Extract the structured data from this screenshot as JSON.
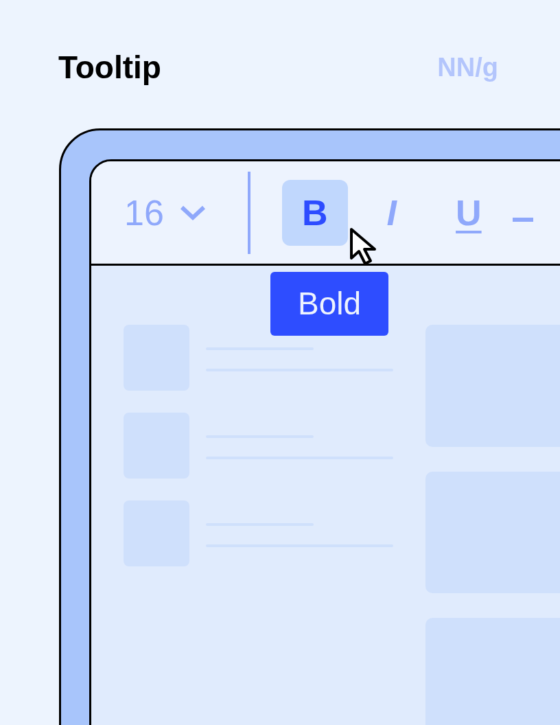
{
  "title": "Tooltip",
  "logo": "NN/g",
  "toolbar": {
    "font_size": "16",
    "buttons": [
      {
        "label": "B",
        "kind": "bold",
        "selected": true
      },
      {
        "label": "I",
        "kind": "italic",
        "selected": false
      },
      {
        "label": "U",
        "kind": "underline",
        "selected": false
      }
    ]
  },
  "tooltip": "Bold"
}
